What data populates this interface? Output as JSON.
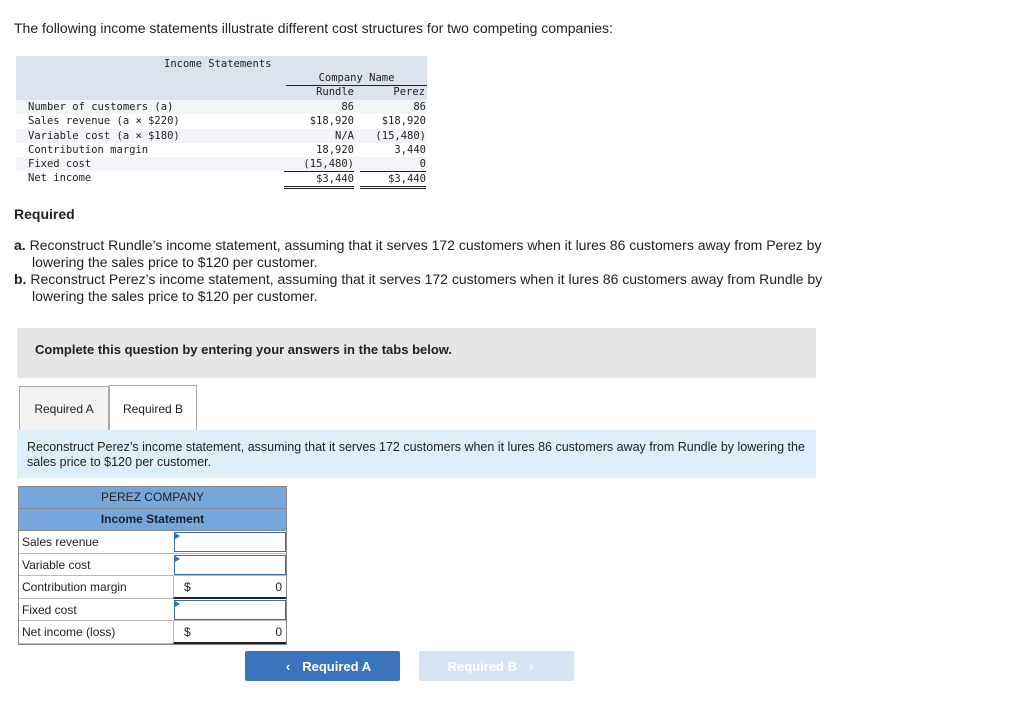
{
  "intro": "The following income statements illustrate different cost structures for two competing companies:",
  "statement": {
    "title": "Income Statements",
    "group_header": "Company Name",
    "columns": [
      "Rundle",
      "Perez"
    ],
    "rows": [
      {
        "label": "Number of customers (a)",
        "rundle": "86",
        "perez": "86"
      },
      {
        "label": "Sales revenue (a × $220)",
        "rundle": "$18,920",
        "perez": "$18,920"
      },
      {
        "label": "Variable cost (a × $180)",
        "rundle": "N/A",
        "perez": "(15,480)"
      },
      {
        "label": "Contribution margin",
        "rundle": "18,920",
        "perez": "3,440"
      },
      {
        "label": "Fixed cost",
        "rundle": "(15,480)",
        "perez": "0"
      },
      {
        "label": "Net income",
        "rundle": "$3,440",
        "perez": "$3,440"
      }
    ]
  },
  "required": {
    "title": "Required",
    "items": [
      {
        "marker": "a.",
        "text": "Reconstruct Rundle’s income statement, assuming that it serves 172 customers when it lures 86 customers away from Perez by lowering the sales price to $120 per customer."
      },
      {
        "marker": "b.",
        "text": "Reconstruct Perez’s income statement, assuming that it serves 172 customers when it lures 86 customers away from Rundle by lowering the sales price to $120 per customer."
      }
    ]
  },
  "banner": "Complete this question by entering your answers in the tabs below.",
  "tabs": [
    {
      "label": "Required A",
      "active": false
    },
    {
      "label": "Required B",
      "active": true
    }
  ],
  "instruction": "Reconstruct Perez’s income statement, assuming that it serves 172 customers when it lures 86 customers away from Rundle by lowering the sales price to $120 per customer.",
  "form": {
    "company": "PEREZ COMPANY",
    "title": "Income Statement",
    "rows": [
      {
        "label": "Sales revenue",
        "type": "input",
        "value": ""
      },
      {
        "label": "Variable cost",
        "type": "input",
        "value": ""
      },
      {
        "label": "Contribution margin",
        "type": "computed",
        "currency": "$",
        "value": "0"
      },
      {
        "label": "Fixed cost",
        "type": "input",
        "value": ""
      },
      {
        "label": "Net income (loss)",
        "type": "computed",
        "currency": "$",
        "value": "0"
      }
    ]
  },
  "nav": {
    "prev_label": "Required A",
    "next_label": "Required B",
    "prev_icon": "chevron-left-icon",
    "next_icon": "chevron-right-icon"
  }
}
